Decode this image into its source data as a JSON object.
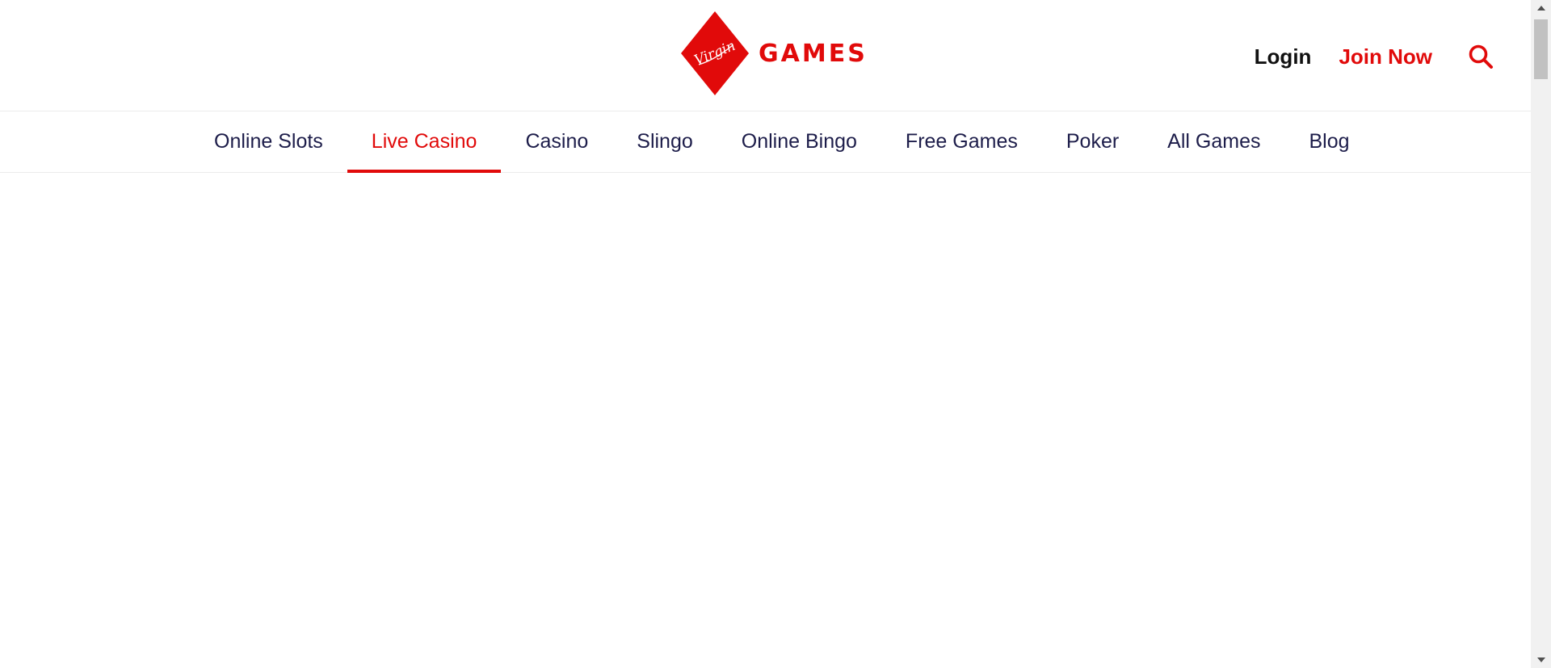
{
  "brand": {
    "logo_script": "Virgin",
    "logo_word": "GAMES",
    "accent_color": "#e10a0a"
  },
  "header": {
    "login_label": "Login",
    "join_label": "Join Now",
    "search_icon": "search-icon"
  },
  "nav": {
    "items": [
      {
        "label": "Online Slots",
        "active": false
      },
      {
        "label": "Live Casino",
        "active": true
      },
      {
        "label": "Casino",
        "active": false
      },
      {
        "label": "Slingo",
        "active": false
      },
      {
        "label": "Online Bingo",
        "active": false
      },
      {
        "label": "Free Games",
        "active": false
      },
      {
        "label": "Poker",
        "active": false
      },
      {
        "label": "All Games",
        "active": false
      },
      {
        "label": "Blog",
        "active": false
      }
    ]
  },
  "colors": {
    "nav_text": "#1d1d4a",
    "login_text": "#111111",
    "divider": "#ececec"
  }
}
